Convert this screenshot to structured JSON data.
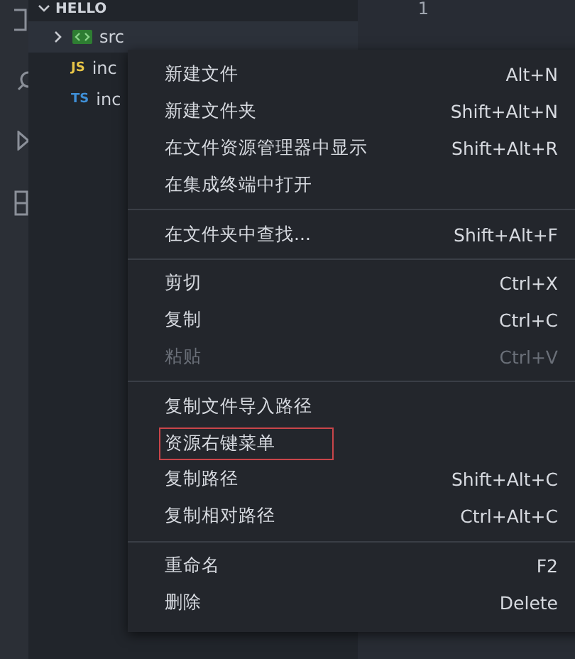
{
  "explorer": {
    "title": "HELLO",
    "expanded": true,
    "items": [
      {
        "label": "src",
        "kind": "folder",
        "expanded": false,
        "selected": true
      },
      {
        "label": "inc",
        "kind": "js",
        "badge": "JS",
        "selected": false
      },
      {
        "label": "inc",
        "kind": "ts",
        "badge": "TS",
        "selected": false
      }
    ]
  },
  "editor": {
    "line_numbers": [
      "1"
    ]
  },
  "context_menu": {
    "items": [
      {
        "kind": "item",
        "label": "新建文件",
        "shortcut": "Alt+N",
        "disabled": false,
        "highlighted": false
      },
      {
        "kind": "item",
        "label": "新建文件夹",
        "shortcut": "Shift+Alt+N",
        "disabled": false,
        "highlighted": false
      },
      {
        "kind": "item",
        "label": "在文件资源管理器中显示",
        "shortcut": "Shift+Alt+R",
        "disabled": false,
        "highlighted": false
      },
      {
        "kind": "item",
        "label": "在集成终端中打开",
        "disabled": false,
        "highlighted": false
      },
      {
        "kind": "separator"
      },
      {
        "kind": "item",
        "label": "在文件夹中查找...",
        "shortcut": "Shift+Alt+F",
        "disabled": false,
        "highlighted": false
      },
      {
        "kind": "separator"
      },
      {
        "kind": "item",
        "label": "剪切",
        "shortcut": "Ctrl+X",
        "disabled": false,
        "highlighted": false
      },
      {
        "kind": "item",
        "label": "复制",
        "shortcut": "Ctrl+C",
        "disabled": false,
        "highlighted": false
      },
      {
        "kind": "item",
        "label": "粘贴",
        "shortcut": "Ctrl+V",
        "disabled": true,
        "highlighted": false
      },
      {
        "kind": "separator"
      },
      {
        "kind": "item",
        "label": "复制文件导入路径",
        "disabled": false,
        "highlighted": false
      },
      {
        "kind": "item",
        "label": "资源右键菜单",
        "disabled": false,
        "highlighted": true
      },
      {
        "kind": "item",
        "label": "复制路径",
        "shortcut": "Shift+Alt+C",
        "disabled": false,
        "highlighted": false
      },
      {
        "kind": "item",
        "label": "复制相对路径",
        "shortcut": "Ctrl+Alt+C",
        "disabled": false,
        "highlighted": false
      },
      {
        "kind": "separator"
      },
      {
        "kind": "item",
        "label": "重命名",
        "shortcut": "F2",
        "disabled": false,
        "highlighted": false
      },
      {
        "kind": "item",
        "label": "删除",
        "shortcut": "Delete",
        "disabled": false,
        "highlighted": false
      }
    ]
  }
}
